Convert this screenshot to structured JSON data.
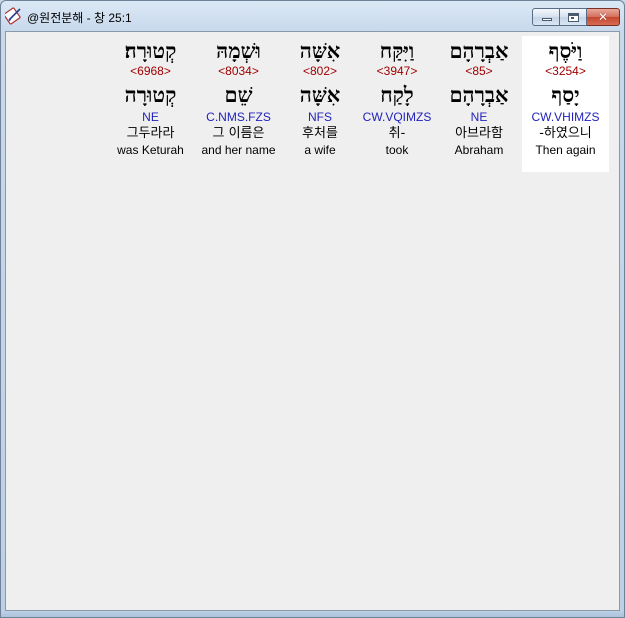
{
  "window": {
    "title": "@원전분해 - 창 25:1",
    "app_icon": "pen-book-icon",
    "buttons": {
      "minimize": "minimize",
      "maximize": "maximize",
      "close": "close"
    },
    "close_glyph": "✕"
  },
  "words": [
    {
      "hebrew": "וַיֹּסֶף",
      "strong": "<3254>",
      "lemma": "יָסַף",
      "parse": "CW.VHIMZS",
      "korean": "-하였으니",
      "english": "Then again",
      "selected": true
    },
    {
      "hebrew": "אַבְרָהָם",
      "strong": "<85>",
      "lemma": "אַבְרָהָם",
      "parse": "NE",
      "korean": "아브라함",
      "english": "Abraham",
      "selected": false
    },
    {
      "hebrew": "וַיִּקַּח",
      "strong": "<3947>",
      "lemma": "לָקַח",
      "parse": "CW.VQIMZS",
      "korean": "취-",
      "english": "took",
      "selected": false
    },
    {
      "hebrew": "אִשָּׁה",
      "strong": "<802>",
      "lemma": "אִשָּׁה",
      "parse": "NFS",
      "korean": "후처를",
      "english": "a wife",
      "selected": false
    },
    {
      "hebrew": "וּשְׁמָהּ",
      "strong": "<8034>",
      "lemma": "שֵׁם",
      "parse": "C.NMS.FZS",
      "korean": "그 이름은",
      "english": "and her name",
      "selected": false
    },
    {
      "hebrew": "קְטוּרָה׃",
      "strong": "<6968>",
      "lemma": "קְטוּרָה",
      "parse": "NE",
      "korean": "그두라라",
      "english": "was Keturah",
      "selected": false
    }
  ]
}
